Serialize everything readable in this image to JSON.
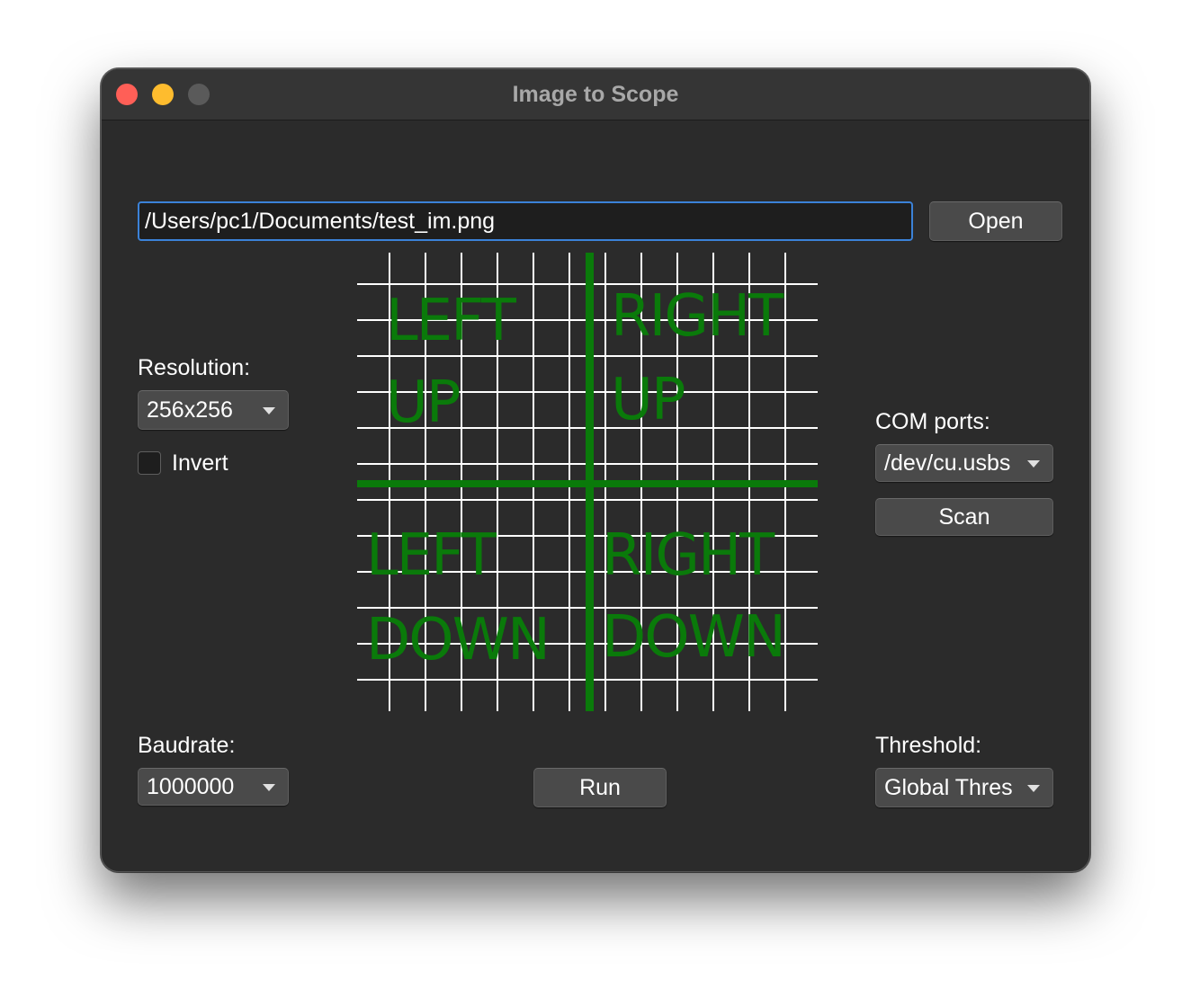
{
  "window": {
    "title": "Image to Scope"
  },
  "file": {
    "path": "/Users/pc1/Documents/test_im.png",
    "open_label": "Open"
  },
  "resolution": {
    "label": "Resolution:",
    "value": "256x256"
  },
  "invert": {
    "label": "Invert",
    "checked": false
  },
  "baudrate": {
    "label": "Baudrate:",
    "value": "1000000"
  },
  "com": {
    "label": "COM ports:",
    "value": "/dev/cu.usbs",
    "scan_label": "Scan"
  },
  "threshold": {
    "label": "Threshold:",
    "value": "Global Thres"
  },
  "run": {
    "label": "Run"
  },
  "preview": {
    "grid_color": "#ffffff",
    "ink_color": "#0a7a0a",
    "background": "#2b2b2b",
    "quadrants": [
      {
        "line1": "LEFT",
        "line2": "UP"
      },
      {
        "line1": "RIGHT",
        "line2": "UP"
      },
      {
        "line1": "LEFT",
        "line2": "DOWN"
      },
      {
        "line1": "RIGHT",
        "line2": "DOWN"
      }
    ]
  }
}
